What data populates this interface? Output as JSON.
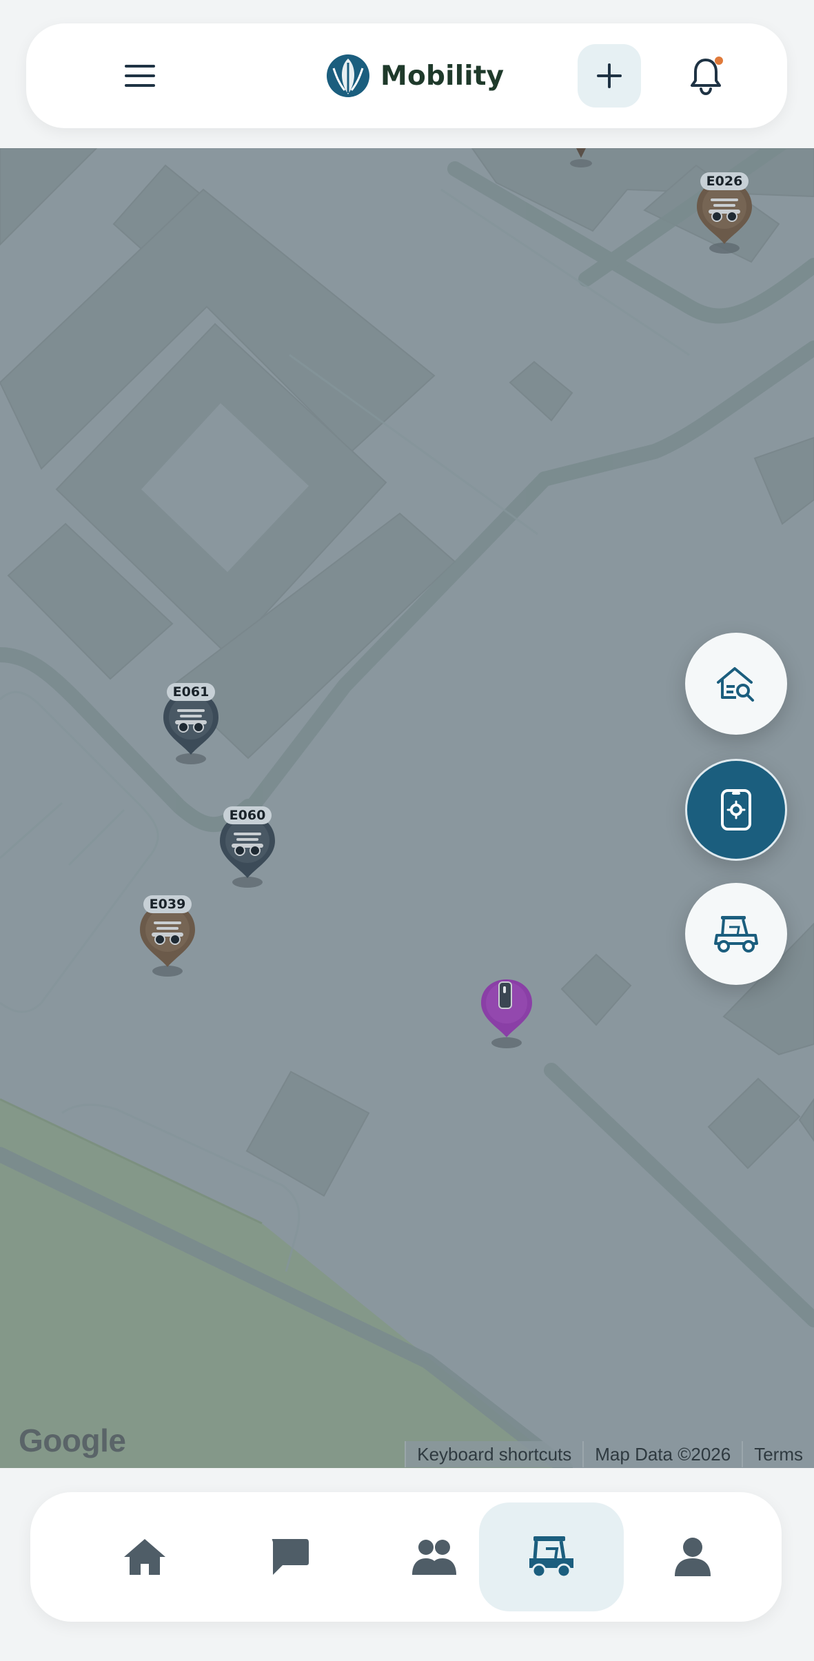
{
  "header": {
    "brand_name": "Mobility",
    "icons": {
      "menu": "menu-icon",
      "logo": "leaf-logo-icon",
      "add": "plus-icon",
      "notifications": "bell-icon"
    },
    "notification_dot_color": "#e07a3a"
  },
  "map": {
    "logo_text": "Google",
    "attribution": {
      "keyboard_shortcuts": "Keyboard shortcuts",
      "map_data": "Map Data ©2026",
      "terms": "Terms"
    },
    "markers": [
      {
        "id": "E026",
        "color": "#6b5a4a"
      },
      {
        "id": "E061",
        "color": "#3c4b58"
      },
      {
        "id": "E060",
        "color": "#3c4b58"
      },
      {
        "id": "E039",
        "color": "#6b5a4a"
      }
    ],
    "user_marker": {
      "icon": "phone-icon",
      "color": "#8a3fa6"
    }
  },
  "fabs": [
    {
      "name": "home-search",
      "icon": "home-search-icon"
    },
    {
      "name": "locate-device",
      "icon": "device-locate-icon"
    },
    {
      "name": "golf-cart",
      "icon": "golf-cart-icon"
    }
  ],
  "bottom_nav": {
    "items": [
      {
        "name": "home",
        "icon": "home-icon"
      },
      {
        "name": "chat",
        "icon": "chat-icon"
      },
      {
        "name": "people",
        "icon": "people-icon"
      },
      {
        "name": "cart",
        "icon": "golf-cart-icon",
        "active": true
      },
      {
        "name": "profile",
        "icon": "user-icon"
      }
    ]
  },
  "colors": {
    "accent": "#1b5e7e",
    "map_background": "#8a979e",
    "active_tab_background": "#e6f0f3"
  }
}
